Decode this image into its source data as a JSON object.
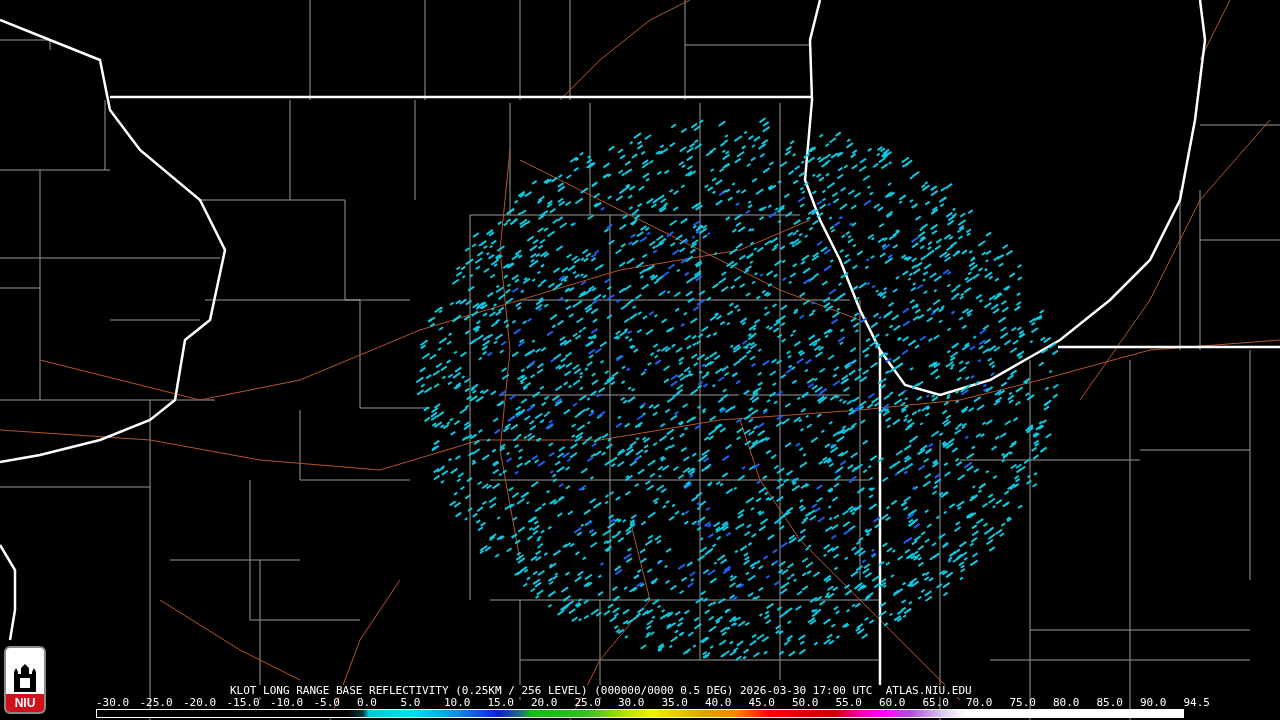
{
  "logo": {
    "text": "NIU"
  },
  "title": "KLOT LONG RANGE BASE REFLECTIVITY (0.25KM / 256 LEVEL) (000000/0000 0.5 DEG) 2026-03-30 17:00 UTC  ATLAS.NIU.EDU",
  "legend": {
    "labels": [
      "-30.0",
      "-25.0",
      "-20.0",
      "-15.0",
      "-10.0",
      "-5.0",
      "0.0",
      "5.0",
      "10.0",
      "15.0",
      "20.0",
      "25.0",
      "30.0",
      "35.0",
      "40.0",
      "45.0",
      "50.0",
      "55.0",
      "60.0",
      "65.0",
      "70.0",
      "75.0",
      "80.0",
      "85.0",
      "90.0",
      "94.5"
    ]
  }
}
